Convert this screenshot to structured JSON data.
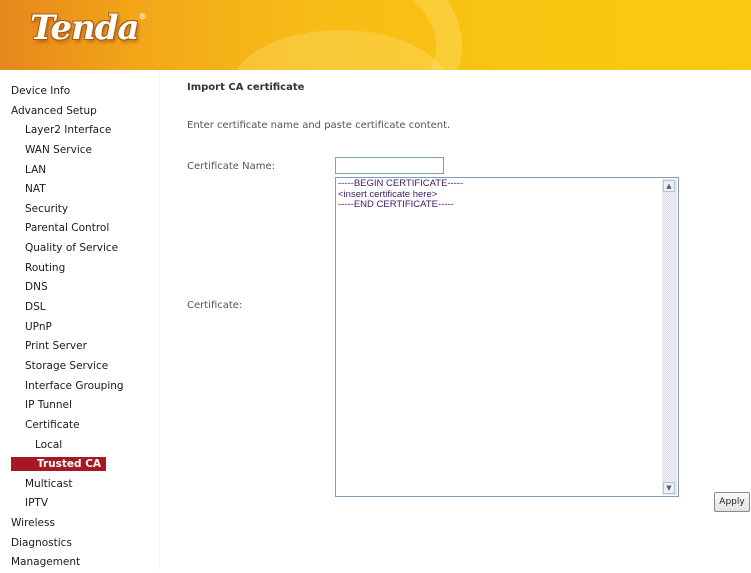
{
  "brand": {
    "logo_text": "Tenda",
    "registered_mark": "®"
  },
  "sidebar": {
    "items": [
      {
        "label": "Device Info",
        "level": 0
      },
      {
        "label": "Advanced Setup",
        "level": 0
      },
      {
        "label": "Layer2 Interface",
        "level": 1
      },
      {
        "label": "WAN Service",
        "level": 1
      },
      {
        "label": "LAN",
        "level": 1
      },
      {
        "label": "NAT",
        "level": 1
      },
      {
        "label": "Security",
        "level": 1
      },
      {
        "label": "Parental Control",
        "level": 1
      },
      {
        "label": "Quality of Service",
        "level": 1
      },
      {
        "label": "Routing",
        "level": 1
      },
      {
        "label": "DNS",
        "level": 1
      },
      {
        "label": "DSL",
        "level": 1
      },
      {
        "label": "UPnP",
        "level": 1
      },
      {
        "label": "Print Server",
        "level": 1
      },
      {
        "label": "Storage Service",
        "level": 1
      },
      {
        "label": "Interface Grouping",
        "level": 1
      },
      {
        "label": "IP Tunnel",
        "level": 1
      },
      {
        "label": "Certificate",
        "level": 1
      },
      {
        "label": "Local",
        "level": 2
      },
      {
        "label": "Trusted CA",
        "level": 2,
        "active": true
      },
      {
        "label": "Multicast",
        "level": 1
      },
      {
        "label": "IPTV",
        "level": 1
      },
      {
        "label": "Wireless",
        "level": 0
      },
      {
        "label": "Diagnostics",
        "level": 0
      },
      {
        "label": "Management",
        "level": 0
      }
    ]
  },
  "main": {
    "title": "Import CA certificate",
    "description": "Enter certificate name and paste certificate content.",
    "certificate_name_label": "Certificate Name:",
    "certificate_name_value": "",
    "certificate_label": "Certificate:",
    "certificate_content": "-----BEGIN CERTIFICATE-----\n<insert certificate here>\n-----END CERTIFICATE-----",
    "apply_label": "Apply"
  },
  "colors": {
    "active_item_bg": "#a61923",
    "header_orange": "#f2a618",
    "header_yellow": "#fac912"
  }
}
